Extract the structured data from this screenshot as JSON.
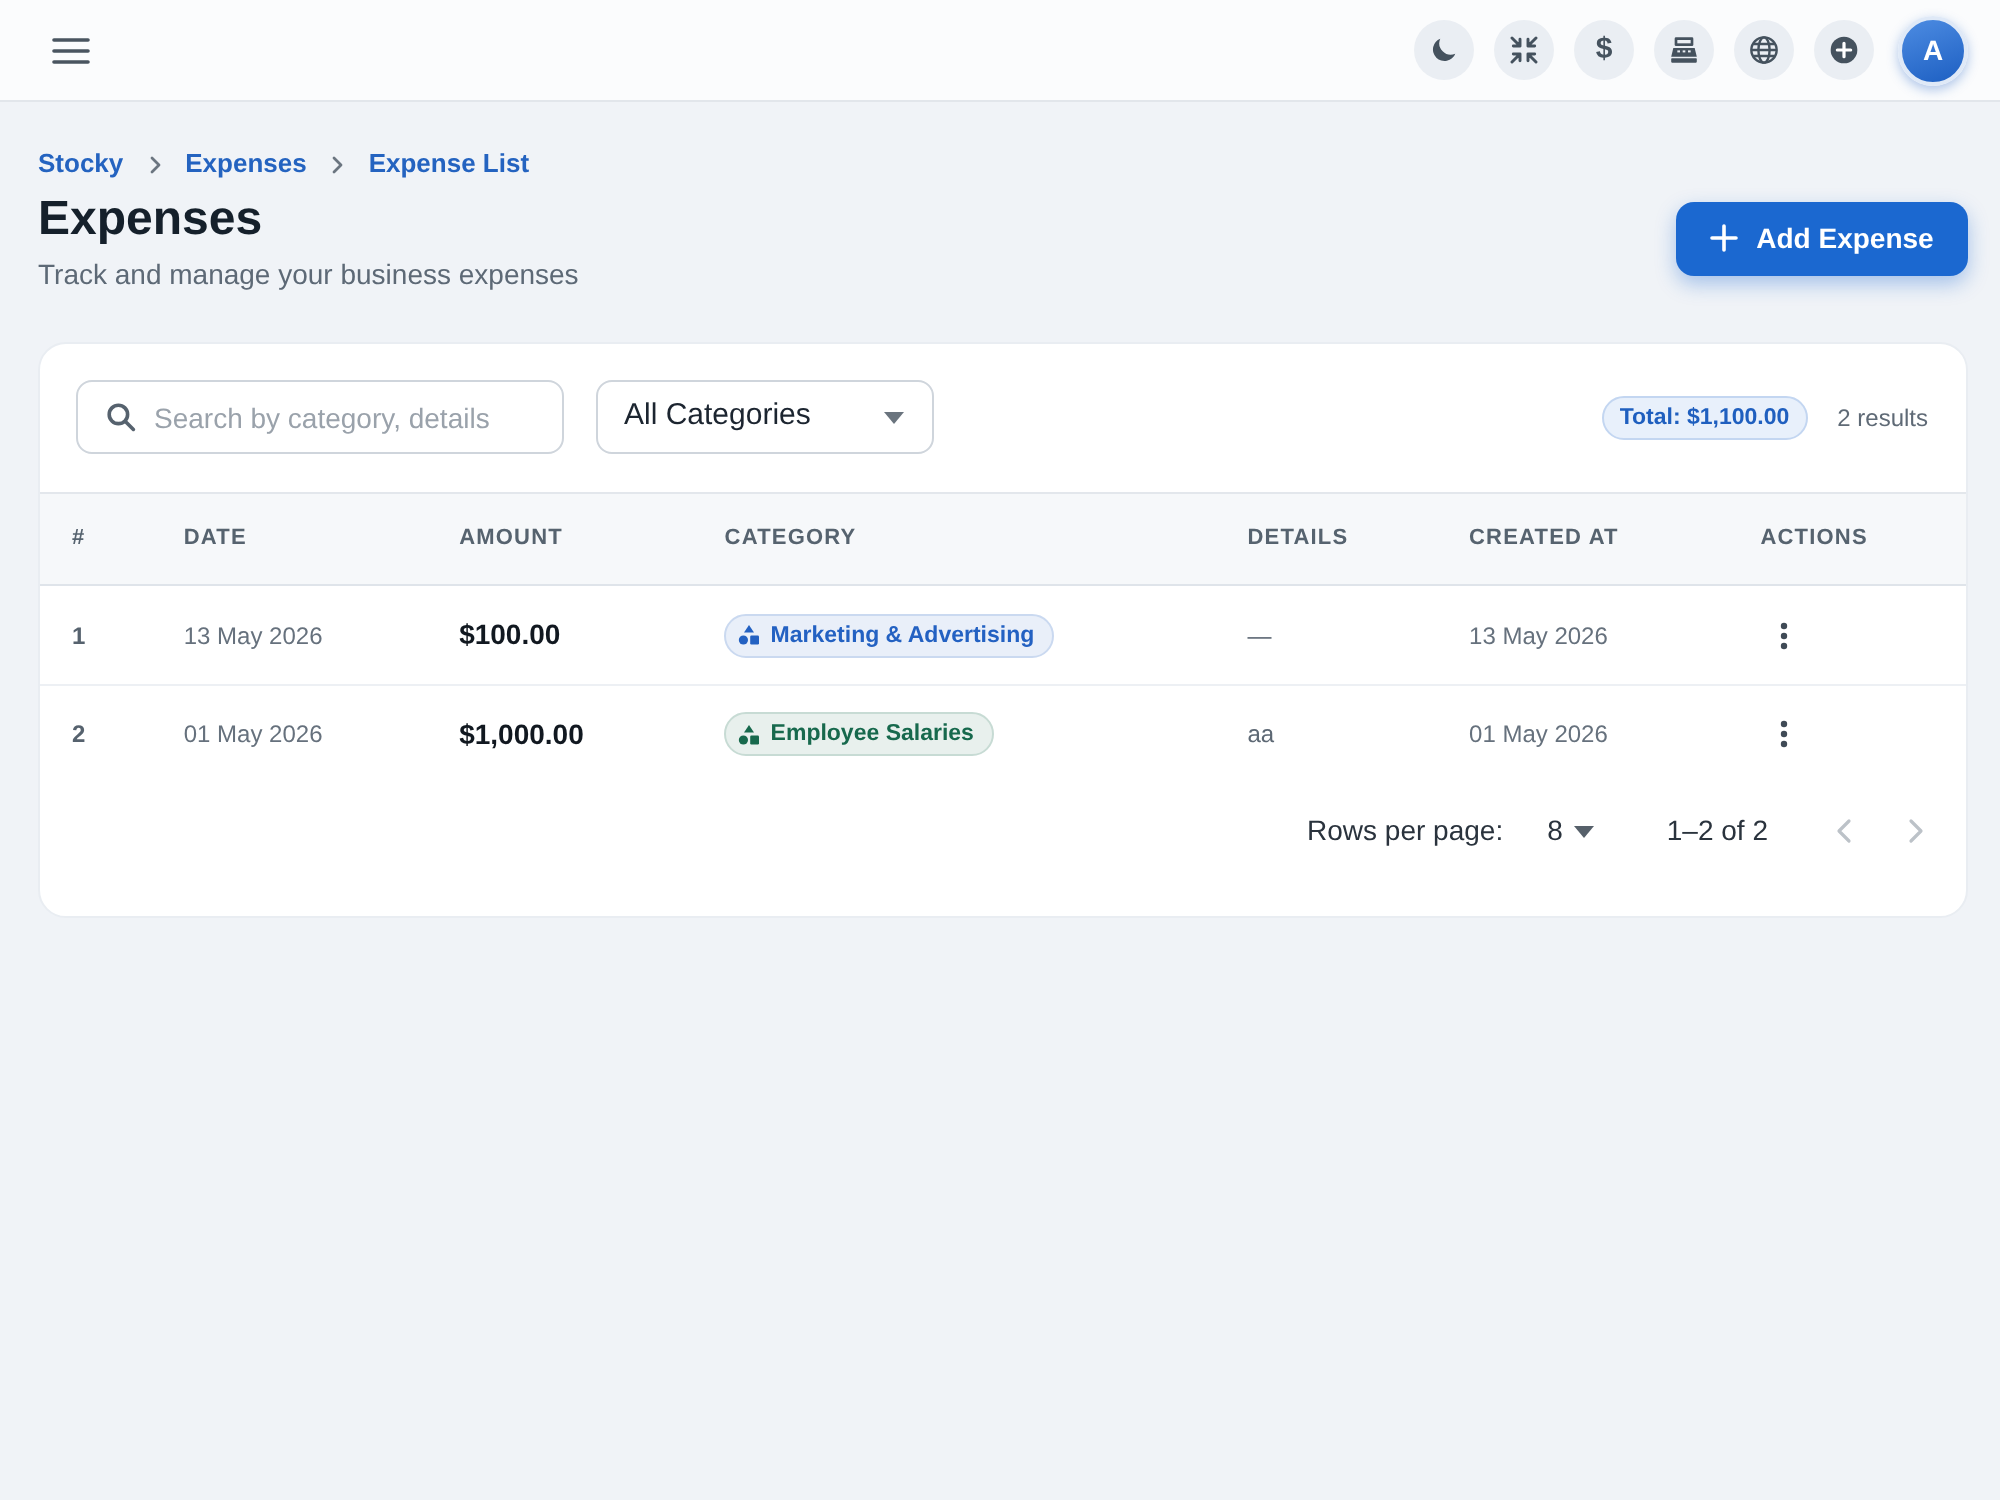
{
  "topbar": {
    "currency_symbol": "$",
    "avatar_initial": "A"
  },
  "breadcrumb": [
    {
      "label": "Stocky"
    },
    {
      "label": "Expenses"
    },
    {
      "label": "Expense List"
    }
  ],
  "header": {
    "title": "Expenses",
    "subtitle": "Track and manage your business expenses",
    "add_button": "Add Expense"
  },
  "filters": {
    "search": {
      "placeholder": "Search by category, details"
    },
    "category_select": {
      "value": "All Categories"
    },
    "total": "Total: $1,100.00",
    "result_count": "2 results"
  },
  "table": {
    "columns": [
      "#",
      "DATE",
      "AMOUNT",
      "CATEGORY",
      "DETAILS",
      "CREATED AT",
      "ACTIONS"
    ],
    "rows": [
      {
        "index": "1",
        "date": "13 May 2026",
        "amount": "$100.00",
        "category": {
          "label": "Marketing & Advertising",
          "color": "#2361c2"
        },
        "details": "—",
        "created_at": "13 May 2026"
      },
      {
        "index": "2",
        "date": "01 May 2026",
        "amount": "$1,000.00",
        "category": {
          "label": "Employee Salaries",
          "color": "#17694d"
        },
        "details": "aa",
        "created_at": "01 May 2026"
      }
    ]
  },
  "pagination": {
    "rows_per_page_label": "Rows per page:",
    "rows_per_page": "8",
    "range": "1–2 of 2",
    "prev": {
      "disabled": true
    },
    "next": {
      "disabled": true
    }
  }
}
